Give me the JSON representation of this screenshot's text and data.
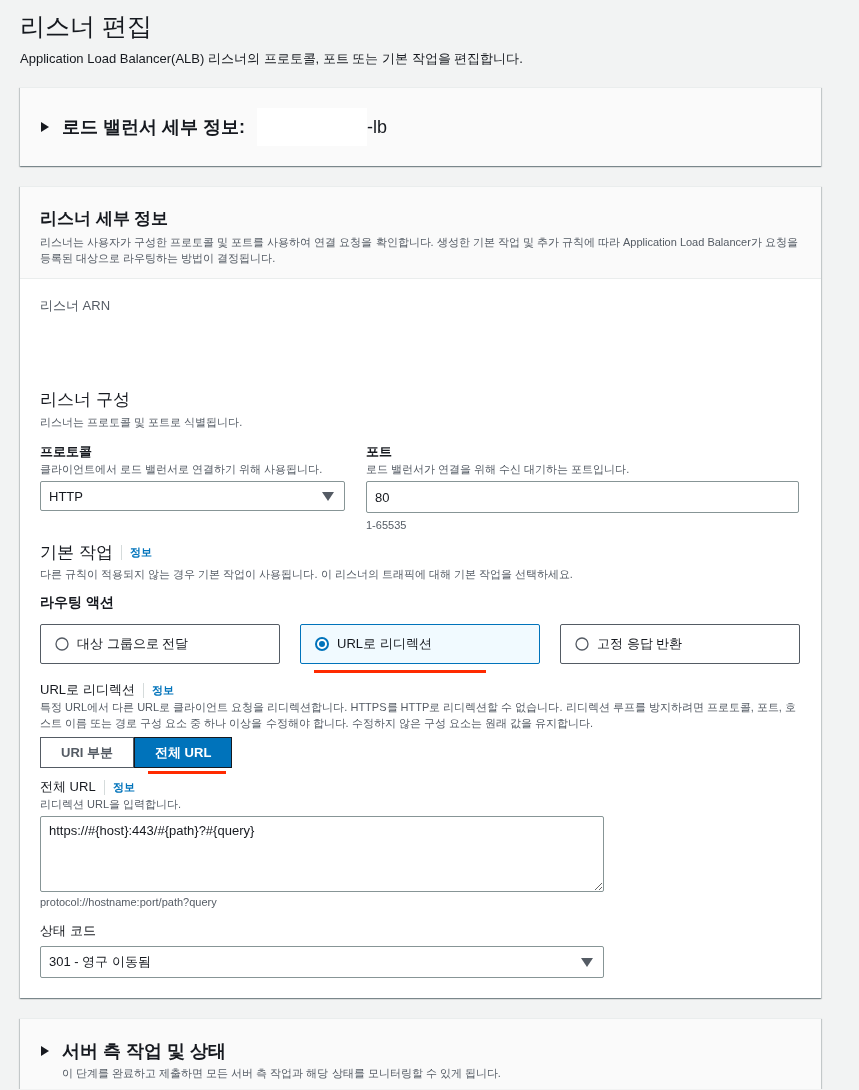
{
  "page": {
    "title": "리스너 편집",
    "description": "Application Load Balancer(ALB) 리스너의 프로토콜, 포트 또는 기본 작업을 편집합니다."
  },
  "load_balancer_panel": {
    "label": "로드 밸런서 세부 정보:",
    "name_suffix": "-lb",
    "redacted": true,
    "expanded": false
  },
  "listener_details": {
    "title": "리스너 세부 정보",
    "description": "리스너는 사용자가 구성한 프로토콜 및 포트를 사용하여 연결 요청을 확인합니다. 생성한 기본 작업 및 추가 규칙에 따라 Application Load Balancer가 요청을 등록된 대상으로 라우팅하는 방법이 결정됩니다.",
    "arn_label": "리스너 ARN",
    "config_title": "리스너 구성",
    "config_description": "리스너는 프로토콜 및 포트로 식별됩니다.",
    "protocol": {
      "label": "프로토콜",
      "description": "클라이언트에서 로드 밸런서로 연결하기 위해 사용됩니다.",
      "value": "HTTP"
    },
    "port": {
      "label": "포트",
      "description": "로드 밸런서가 연결을 위해 수신 대기하는 포트입니다.",
      "value": "80",
      "hint": "1-65535"
    },
    "default_action": {
      "title": "기본 작업",
      "info": "정보",
      "description": "다른 규칙이 적용되지 않는 경우 기본 작업이 사용됩니다. 이 리스너의 트래픽에 대해 기본 작업을 선택하세요."
    },
    "routing_action": {
      "label": "라우팅 액션",
      "options": [
        {
          "label": "대상 그룹으로 전달",
          "selected": false,
          "highlighted": false
        },
        {
          "label": "URL로 리디렉션",
          "selected": true,
          "highlighted": true
        },
        {
          "label": "고정 응답 반환",
          "selected": false,
          "highlighted": false
        }
      ]
    },
    "redirect": {
      "title": "URL로 리디렉션",
      "info": "정보",
      "description": "특정 URL에서 다른 URL로 클라이언트 요청을 리디렉션합니다. HTTPS를 HTTP로 리디렉션할 수 없습니다. 리디렉션 루프를 방지하려면 프로토콜, 포트, 호스트 이름 또는 경로 구성 요소 중 하나 이상을 수정해야 합니다. 수정하지 않은 구성 요소는 원래 값을 유지합니다.",
      "segments": [
        {
          "label": "URI 부분",
          "selected": false,
          "highlighted": false
        },
        {
          "label": "전체 URL",
          "selected": true,
          "highlighted": true
        }
      ],
      "full_url": {
        "label": "전체 URL",
        "info": "정보",
        "description": "리디렉션 URL을 입력합니다.",
        "value": "https://#{host}:443/#{path}?#{query}",
        "hint": "protocol://hostname:port/path?query"
      },
      "status_code": {
        "label": "상태 코드",
        "value": "301 - 영구 이동됨"
      }
    }
  },
  "server_side_panel": {
    "title": "서버 측 작업 및 상태",
    "description": "이 단계를 완료하고 제출하면 모든 서버 측 작업과 해당 상태를 모니터링할 수 있게 됩니다.",
    "expanded": false
  }
}
